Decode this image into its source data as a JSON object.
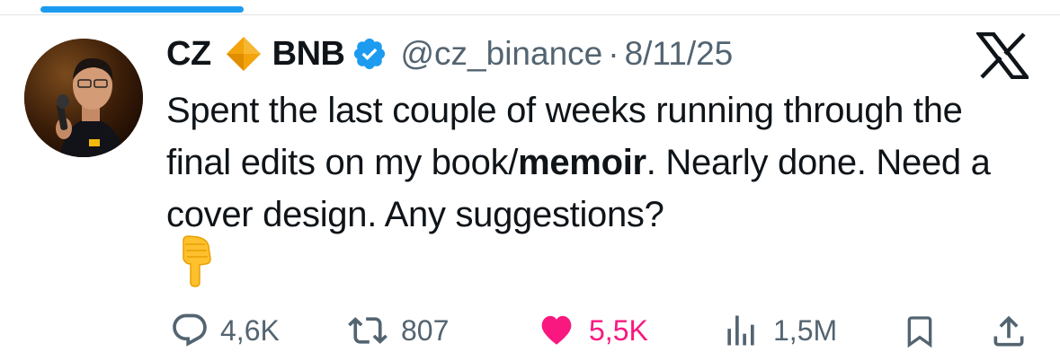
{
  "tweet": {
    "author_name": "CZ",
    "author_name_suffix": "BNB",
    "handle": "@cz_binance",
    "separator": "·",
    "date": "8/11/25",
    "text_part1": "Spent the last couple of weeks running through the final edits on my book/",
    "text_bold": "memoir",
    "text_part2": ". Nearly done. Need a cover design. Any suggestions?",
    "emoji": "👇"
  },
  "metrics": {
    "replies": "4,6K",
    "reposts": "807",
    "likes": "5,5K",
    "views": "1,5M"
  },
  "colors": {
    "accent": "#1d9bf0",
    "like": "#f91880",
    "secondary_text": "#536471",
    "diamond": "#f3a30c"
  },
  "icons": [
    "diamond-icon",
    "verified-icon",
    "x-logo-icon",
    "reply-icon",
    "repost-icon",
    "heart-icon",
    "views-icon",
    "bookmark-icon",
    "share-icon"
  ]
}
